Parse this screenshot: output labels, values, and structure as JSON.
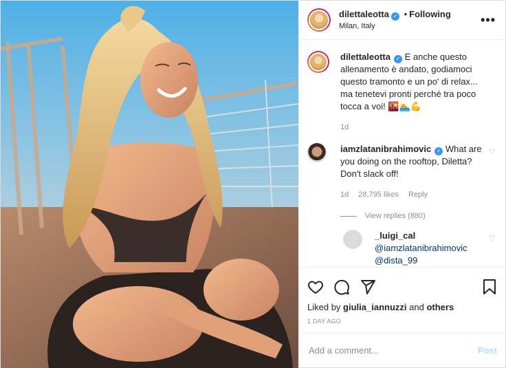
{
  "header": {
    "username": "dilettaleotta",
    "separator": "•",
    "follow_status": "Following",
    "location": "Milan, Italy",
    "more": "•••"
  },
  "caption": {
    "username": "dilettaleotta",
    "text": "E anche questo allenamento è andato, godiamoci questo tramonto e un po' di relax... ma tenetevi pronti perché tra poco tocca a voi! 🌇🏊💪",
    "time": "1d"
  },
  "comment": {
    "username": "iamzlatanibrahimovic",
    "text": "What are you doing on the rooftop, Diletta? Don't slack off!",
    "time": "1d",
    "likes": "28,795 likes",
    "reply_label": "Reply",
    "view_replies": "View replies (880)"
  },
  "reply": {
    "username": "_luigi_cal",
    "mention1": "@iamzlatanibrahimovic",
    "mention2": "@dista_99"
  },
  "likes": {
    "prefix": "Liked by",
    "user": "giulia_iannuzzi",
    "conj": "and",
    "others": "others"
  },
  "posted": "1 DAY AGO",
  "add_comment": {
    "placeholder": "Add a comment...",
    "post_label": "Post"
  },
  "icons": {
    "verified": "verified-badge",
    "like": "heart-icon",
    "comment": "comment-icon",
    "share": "paper-plane-icon",
    "save": "bookmark-icon"
  },
  "colors": {
    "verified_blue": "#3897f0",
    "post_disabled": "#b2dffc",
    "mention": "#003569",
    "muted": "#8e8e8e"
  }
}
